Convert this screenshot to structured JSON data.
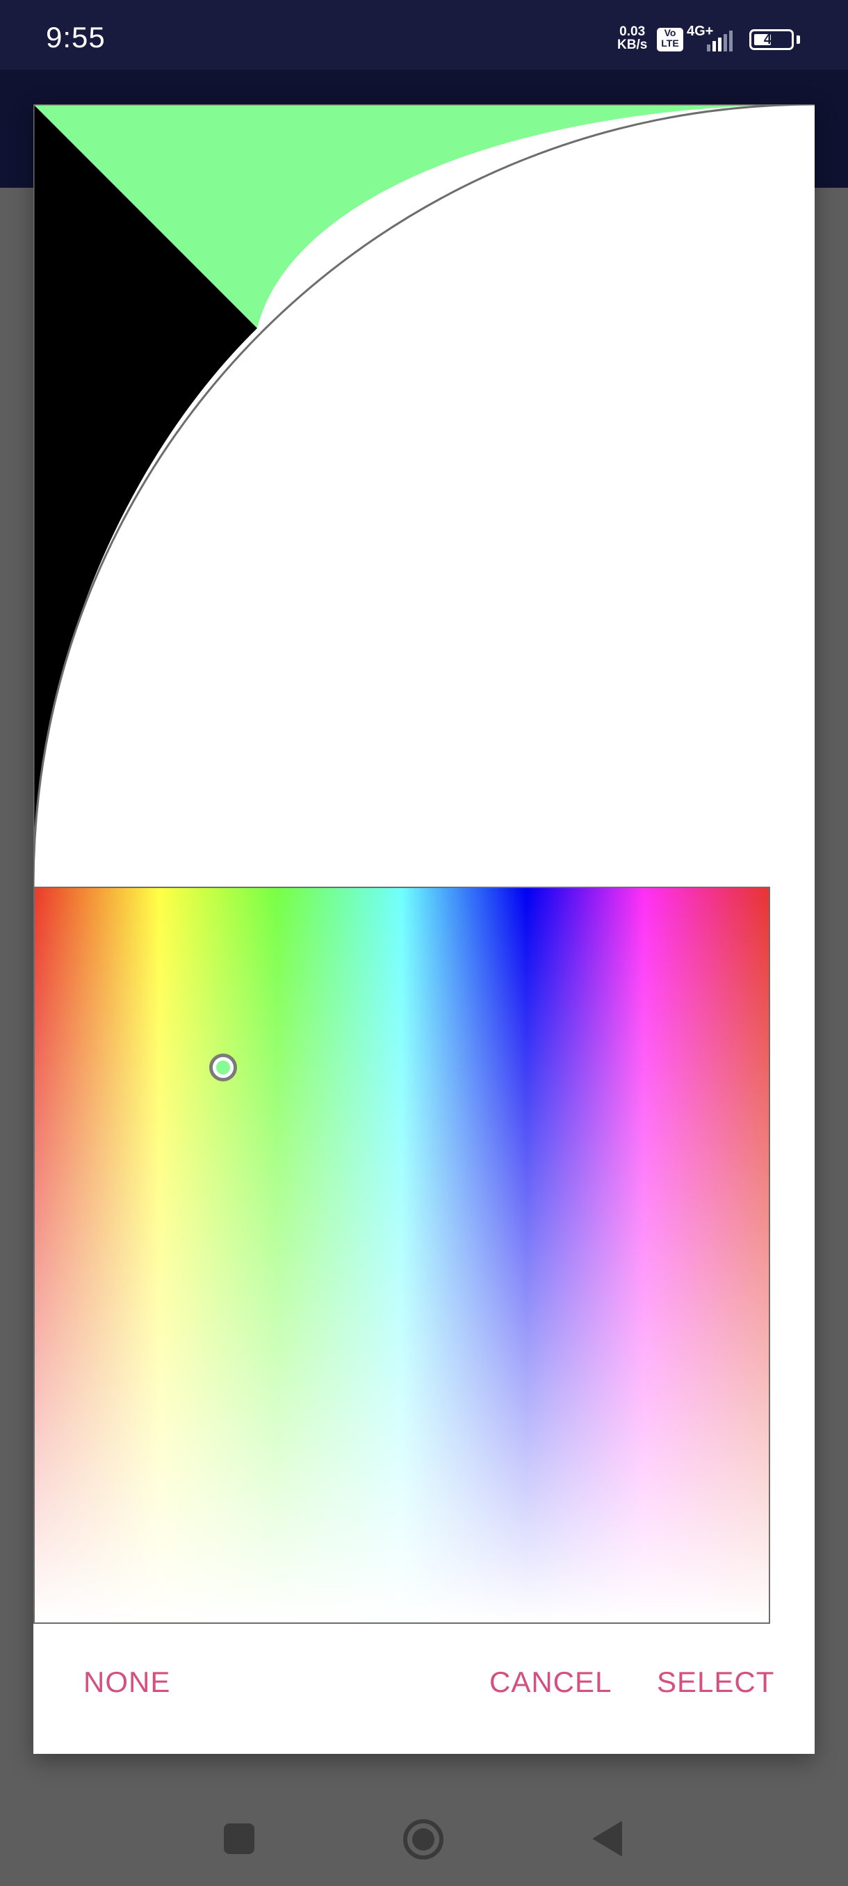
{
  "status_bar": {
    "time": "9:55",
    "net_speed_value": "0.03",
    "net_speed_unit": "KB/s",
    "volte_top": "Vo",
    "volte_bottom": "LTE",
    "network_type": "4G+",
    "battery_level": "47"
  },
  "colors": {
    "status_bar_bg": "#181b3e",
    "preview_selected": "#84fc93",
    "preview_previous": "#000000",
    "accent": "#d4507f"
  },
  "color_picker": {
    "selected_fraction_x": 0.257,
    "selected_fraction_y": 0.244
  },
  "dialog": {
    "buttons": {
      "none": "NONE",
      "cancel": "CANCEL",
      "select": "SELECT"
    }
  },
  "nav_bar": {
    "items": [
      "recent-apps",
      "home",
      "back"
    ]
  }
}
